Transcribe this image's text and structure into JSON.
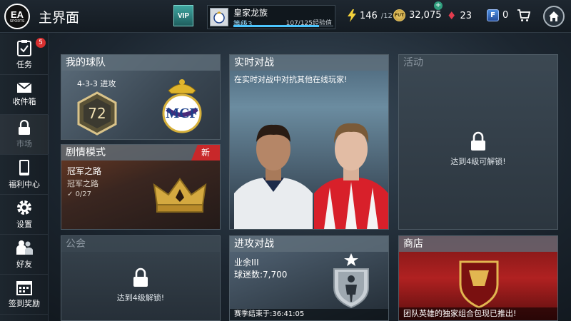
{
  "header": {
    "logo_ea": "EA",
    "logo_sports": "SPORTS",
    "title": "主界面",
    "vip": "VIP",
    "club": {
      "name": "皇家龙族",
      "level": "等级3",
      "xp": "107/125经验值",
      "xp_progress": 0.856
    },
    "energy": "146",
    "energy_max": "/12",
    "coin_label": "FUT",
    "coins": "32,075",
    "gems": "23",
    "fifa_points_label": "F",
    "fifa_points": "0",
    "plus": "+"
  },
  "sidebar": {
    "items": [
      {
        "label": "任务",
        "badge": "5"
      },
      {
        "label": "收件箱"
      },
      {
        "label": "市场"
      },
      {
        "label": "福利中心"
      },
      {
        "label": "设置"
      },
      {
        "label": "好友"
      },
      {
        "label": "签到奖励"
      }
    ]
  },
  "tiles": {
    "my_team": {
      "title": "我的球队",
      "formation": "4-3-3 进攻",
      "rating": "72"
    },
    "story": {
      "title": "剧情模式",
      "new_tag": "新",
      "line1": "冠军之路",
      "line2": "冠军之路",
      "progress": "0/27"
    },
    "live": {
      "title": "实时对战",
      "subtitle": "在实时对战中对抗其他在线玩家!"
    },
    "events": {
      "title": "活动",
      "lock_text": "达到4级可解锁!"
    },
    "guild": {
      "title": "公会",
      "lock_text": "达到4级解锁!"
    },
    "attack": {
      "title": "进攻对战",
      "division": "业余III",
      "fans": "球迷数:7,700",
      "season_end": "赛季结束于:36:41:05"
    },
    "shop": {
      "title": "商店",
      "banner": "团队英雄的独家组合包现已推出!"
    }
  },
  "colors": {
    "accent": "#4cc6ff",
    "new_tag": "#c8282a",
    "badge": "#d93030",
    "gem": "#e23c4e"
  }
}
